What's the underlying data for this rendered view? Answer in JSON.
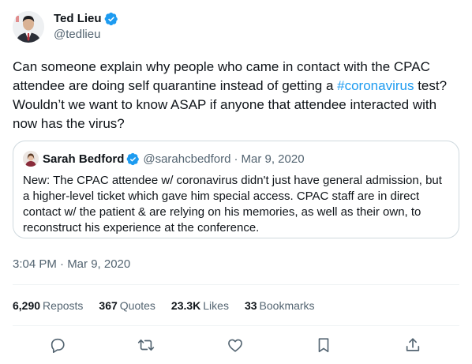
{
  "author": {
    "name": "Ted Lieu",
    "handle": "@tedlieu",
    "avatar_icon": "profile-photo",
    "verified_icon": "verified-badge-icon",
    "verified_color": "#1d9bf0"
  },
  "tweet": {
    "text_before": "Can someone explain why people who came in contact with the CPAC attendee are doing self quarantine instead of getting a ",
    "hashtag": "#coronavirus",
    "text_after": " test? Wouldn’t we want to know ASAP if anyone that attendee interacted with now has the virus?",
    "timestamp": "3:04 PM · Mar 9, 2020"
  },
  "quote": {
    "name": "Sarah Bedford",
    "handle": "@sarahcbedford",
    "separator": "·",
    "date": "Mar 9, 2020",
    "text": "New: The CPAC attendee w/ coronavirus didn't just have general admission, but a higher-level ticket which gave him special access. CPAC staff are in direct contact w/ the patient & are relying on his memories, as well as their own, to reconstruct his experience at the conference."
  },
  "stats": {
    "reposts_count": "6,290",
    "reposts_label": "Reposts",
    "quotes_count": "367",
    "quotes_label": "Quotes",
    "likes_count": "23.3K",
    "likes_label": "Likes",
    "bookmarks_count": "33",
    "bookmarks_label": "Bookmarks"
  },
  "actions": [
    "reply-icon",
    "repost-icon",
    "like-icon",
    "bookmark-icon",
    "share-icon"
  ],
  "colors": {
    "text": "#0f1419",
    "secondary": "#536471",
    "link": "#1d9bf0",
    "border": "#cfd9de"
  }
}
